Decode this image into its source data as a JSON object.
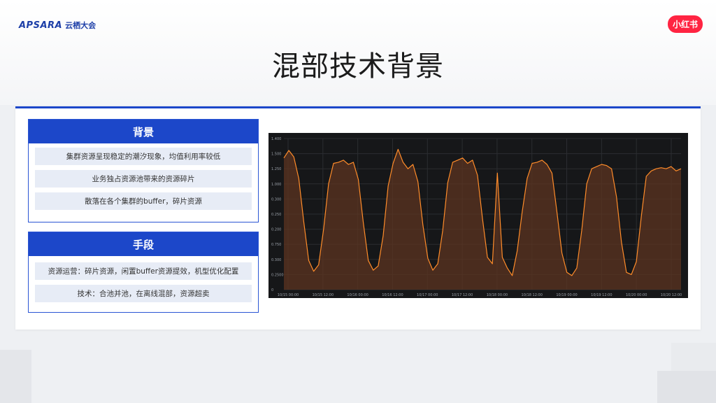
{
  "header": {
    "logo_left": "APSARA",
    "logo_left_cn": "云栖大会",
    "logo_right": "小红书",
    "title": "混部技术背景"
  },
  "sections": [
    {
      "title": "背景",
      "items": [
        "集群资源呈现稳定的潮汐现象，均值利用率较低",
        "业务独占资源池带来的资源碎片",
        "散落在各个集群的buffer，碎片资源"
      ]
    },
    {
      "title": "手段",
      "items": [
        "资源运营：碎片资源，闲置buffer资源提效，机型优化配置",
        "技术：合池并池，在离线混部，资源超卖"
      ]
    }
  ],
  "chart_data": {
    "type": "area",
    "colors": {
      "line": "#ff8c2a",
      "fill": "#5c3420",
      "background": "#161719",
      "grid": "#2b2d31"
    },
    "y_ticks": [
      "0",
      "0.2500",
      "0.300",
      "0.750",
      "0.200",
      "0.250",
      "0.300",
      "1.000",
      "1.250",
      "1.500",
      "1.400"
    ],
    "x_ticks": [
      "10/15 00:00",
      "10/15 12:00",
      "10/16 00:00",
      "10/16 12:00",
      "10/17 00:00",
      "10/17 12:00",
      "10/18 00:00",
      "10/18 12:00",
      "10/19 00:00",
      "10/19 12:00",
      "10/20 00:00",
      "10/20 12:00"
    ],
    "y_range": [
      0,
      1.4
    ],
    "series": [
      {
        "values": [
          1.22,
          1.29,
          1.23,
          1.03,
          0.63,
          0.27,
          0.17,
          0.23,
          0.56,
          0.98,
          1.17,
          1.18,
          1.2,
          1.16,
          1.18,
          1.02,
          0.62,
          0.27,
          0.18,
          0.22,
          0.5,
          0.96,
          1.17,
          1.3,
          1.18,
          1.12,
          1.16,
          1.0,
          0.6,
          0.29,
          0.18,
          0.24,
          0.55,
          0.99,
          1.18,
          1.2,
          1.22,
          1.17,
          1.2,
          1.06,
          0.66,
          0.3,
          0.24,
          1.08,
          0.3,
          0.2,
          0.13,
          0.36,
          0.72,
          1.03,
          1.17,
          1.18,
          1.2,
          1.16,
          1.08,
          0.72,
          0.34,
          0.16,
          0.13,
          0.2,
          0.55,
          0.98,
          1.12,
          1.14,
          1.16,
          1.15,
          1.12,
          0.86,
          0.44,
          0.16,
          0.14,
          0.26,
          0.68,
          1.05,
          1.1,
          1.12,
          1.13,
          1.12,
          1.14,
          1.1,
          1.12
        ]
      }
    ]
  }
}
